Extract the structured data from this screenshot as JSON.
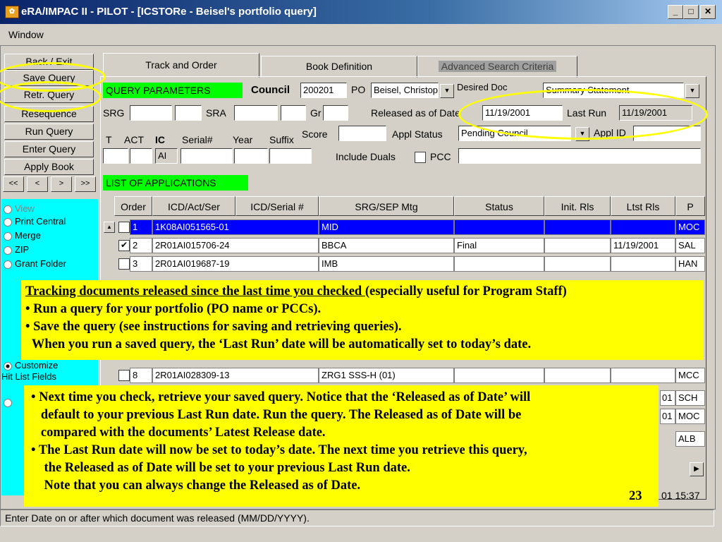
{
  "window": {
    "title": "eRA/IMPAC II - PILOT - [ICSTORe - Beisel's portfolio query]",
    "controls": {
      "minimize": "_",
      "maximize": "□",
      "close": "✕"
    }
  },
  "menu": {
    "window": "Window"
  },
  "left_buttons": [
    "Back / Exit",
    "Save Query",
    "Retr. Query",
    "Resequence",
    "Run Query",
    "Enter Query",
    "Apply Book"
  ],
  "nav_buttons": [
    "<<",
    "<",
    ">",
    ">>"
  ],
  "radio_options": [
    {
      "label": "View",
      "checked": false
    },
    {
      "label": "Print Central",
      "checked": false
    },
    {
      "label": "Merge",
      "checked": false
    },
    {
      "label": "ZIP",
      "checked": false
    },
    {
      "label": "Grant Folder",
      "checked": false
    }
  ],
  "customize": {
    "line1": "Customize",
    "line2": "Hit List Fields",
    "checked": true
  },
  "tabs": [
    "Track and Order",
    "Book Definition",
    "Advanced Search Criteria"
  ],
  "query": {
    "header": "QUERY PARAMETERS",
    "council_label": "Council",
    "council_value": "200201",
    "po_label": "PO",
    "po_value": "Beisel, Christop",
    "desired_doc_label": "Desired Doc",
    "desired_doc_value": "Summary Statement",
    "srg_label": "SRG",
    "sra_label": "SRA",
    "gr_label": "Gr",
    "released_label": "Released as of Date",
    "released_value": "11/19/2001",
    "last_run_label": "Last Run",
    "last_run_value": "11/19/2001",
    "t_label": "T",
    "act_label": "ACT",
    "ic_label": "IC",
    "serial_label": "Serial#",
    "year_label": "Year",
    "suffix_label": "Suffix",
    "score_label": "Score",
    "appl_status_label": "Appl Status",
    "appl_status_value": "Pending Council",
    "applid_label": "Appl ID",
    "ic_value": "AI",
    "include_duals_label": "Include Duals",
    "pcc_label": "PCC"
  },
  "applications": {
    "header": "LIST OF APPLICATIONS",
    "columns": [
      "Order",
      "ICD/Act/Ser",
      "ICD/Serial #",
      "SRG/SEP Mtg",
      "Status",
      "Init. Rls",
      "Ltst Rls",
      "P"
    ],
    "rows": [
      {
        "order": "1",
        "act": "1K08AI051565-01",
        "srg": "MID",
        "status": "",
        "init": "",
        "ltst": "",
        "p": "MOC",
        "checked": false,
        "selected": true
      },
      {
        "order": "2",
        "act": "2R01AI015706-24",
        "srg": "BBCA",
        "status": "Final",
        "init": "",
        "ltst": "11/19/2001",
        "p": "SAL",
        "checked": true,
        "selected": false
      },
      {
        "order": "3",
        "act": "2R01AI019687-19",
        "srg": "IMB",
        "status": "",
        "init": "",
        "ltst": "",
        "p": "HAN",
        "checked": false,
        "selected": false
      },
      {
        "order": "8",
        "act": "2R01AI028309-13",
        "srg": "ZRG1 SSS-H (01)",
        "status": "",
        "init": "",
        "ltst": "",
        "p": "MCC",
        "checked": false,
        "selected": false
      }
    ],
    "partial_right": [
      "01",
      "SCH",
      "01",
      "MOC",
      "ALB"
    ],
    "scroll_right": "▶",
    "timestamp_partial": "01 15:37"
  },
  "callout1": {
    "heading": "Tracking documents released since the last time you checked ",
    "heading_tail": "(especially useful for Program Staff)",
    "lines": [
      "• Run a query for your portfolio (PO name or PCCs).",
      "• Save the query (see instructions for saving and retrieving queries).",
      "  When you run a saved query, the ‘Last Run’ date will be automatically set to today’s date."
    ]
  },
  "callout2": {
    "lines": [
      "• Next time you check, retrieve your saved query. Notice that the ‘Released as of Date’ will",
      "   default to your previous Last Run date. Run the query. The Released as of Date will be",
      "   compared with the documents’ Latest Release date.",
      "• The Last Run date will now be set to today’s date. The next time you retrieve this query,",
      "    the Released as of Date will be set to your previous Last Run date.",
      "    Note that you can always change the Released as of Date."
    ],
    "page_number": "23"
  },
  "status_bar": "Enter Date on or after which document was released (MM/DD/YYYY).",
  "colors": {
    "highlight_green": "#00ff00",
    "callout_yellow": "#ffff00",
    "panel_cyan": "#00ffff",
    "selection_blue": "#0000ff"
  }
}
